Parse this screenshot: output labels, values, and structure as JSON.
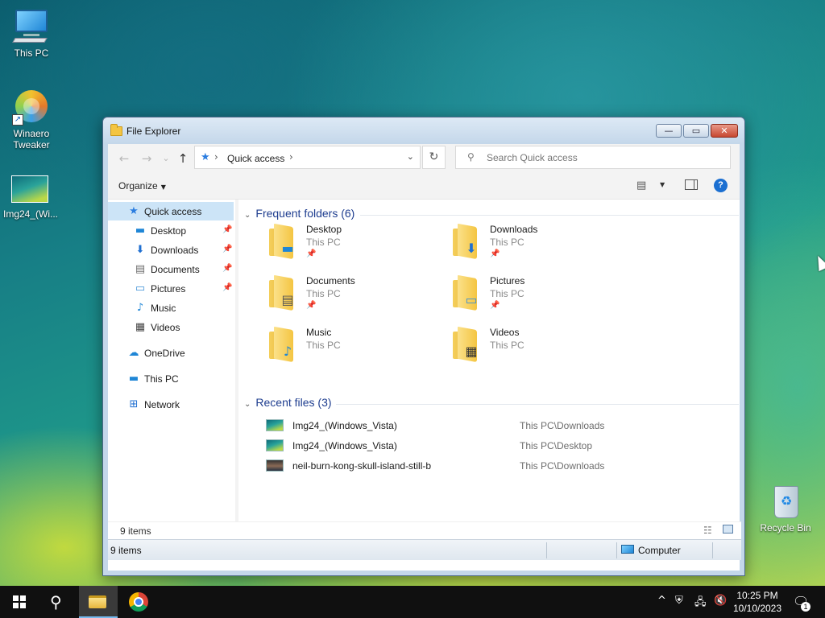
{
  "desktop": {
    "icons": [
      {
        "label": "This PC",
        "icon": "computer-icon"
      },
      {
        "label": "Winaero Tweaker",
        "icon": "winaero-tweaker-icon"
      },
      {
        "label": "Img24_(Wi...",
        "icon": "image-file-icon"
      },
      {
        "label": "Recycle Bin",
        "icon": "recycle-bin-icon"
      }
    ]
  },
  "window": {
    "title": "File Explorer",
    "buttons": {
      "minimize": "—",
      "maximize": "▭",
      "close": "✕"
    },
    "nav": {
      "back": "←",
      "forward": "→",
      "recent": "⌄",
      "up": "↑"
    },
    "address": {
      "location": "Quick access",
      "separator": "›",
      "dropdown": "⌄",
      "refresh": "↻"
    },
    "search": {
      "placeholder": "Search Quick access",
      "value": ""
    },
    "toolbar": {
      "organize": "Organize",
      "help": "?"
    },
    "navpane": [
      {
        "label": "Quick access",
        "icon": "star-icon",
        "glyph": "★",
        "color": "#2b7de0",
        "selected": true,
        "pinned": false,
        "indent": 0
      },
      {
        "label": "Desktop",
        "icon": "desktop-icon",
        "glyph": "▬",
        "color": "#1f86d6",
        "pinned": true,
        "indent": 1
      },
      {
        "label": "Downloads",
        "icon": "downloads-icon",
        "glyph": "⬇",
        "color": "#1f6fd1",
        "pinned": true,
        "indent": 1
      },
      {
        "label": "Documents",
        "icon": "documents-icon",
        "glyph": "▤",
        "color": "#6d6d6d",
        "pinned": true,
        "indent": 1
      },
      {
        "label": "Pictures",
        "icon": "pictures-icon",
        "glyph": "▭",
        "color": "#3a8fd6",
        "pinned": true,
        "indent": 1
      },
      {
        "label": "Music",
        "icon": "music-icon",
        "glyph": "♪",
        "color": "#1f86d6",
        "pinned": false,
        "indent": 1
      },
      {
        "label": "Videos",
        "icon": "videos-icon",
        "glyph": "▦",
        "color": "#444444",
        "pinned": false,
        "indent": 1
      },
      {
        "label": "OneDrive",
        "icon": "onedrive-icon",
        "glyph": "☁",
        "color": "#1f86d6",
        "pinned": false,
        "indent": 0
      },
      {
        "label": "This PC",
        "icon": "this-pc-icon",
        "glyph": "▬",
        "color": "#1f86d6",
        "pinned": false,
        "indent": 0
      },
      {
        "label": "Network",
        "icon": "network-icon",
        "glyph": "⊞",
        "color": "#1f6fd1",
        "pinned": false,
        "indent": 0
      }
    ],
    "pin_glyph": "📌",
    "frequent": {
      "heading": "Frequent folders (6)",
      "items": [
        {
          "name": "Desktop",
          "location": "This PC",
          "pinned": true,
          "badge": "▬",
          "badge_color": "#1f86d6",
          "icon": "desktop-folder-icon"
        },
        {
          "name": "Downloads",
          "location": "This PC",
          "pinned": true,
          "badge": "⬇",
          "badge_color": "#1f6fd1",
          "icon": "downloads-folder-icon"
        },
        {
          "name": "Documents",
          "location": "This PC",
          "pinned": true,
          "badge": "▤",
          "badge_color": "#555555",
          "icon": "documents-folder-icon"
        },
        {
          "name": "Pictures",
          "location": "This PC",
          "pinned": true,
          "badge": "▭",
          "badge_color": "#3a8fd6",
          "icon": "pictures-folder-icon"
        },
        {
          "name": "Music",
          "location": "This PC",
          "pinned": false,
          "badge": "♪",
          "badge_color": "#1f86d6",
          "icon": "music-folder-icon"
        },
        {
          "name": "Videos",
          "location": "This PC",
          "pinned": false,
          "badge": "▦",
          "badge_color": "#333333",
          "icon": "videos-folder-icon"
        }
      ]
    },
    "recent": {
      "heading": "Recent files (3)",
      "items": [
        {
          "name": "Img24_(Windows_Vista)",
          "path": "This PC\\Downloads",
          "thumb": "landscape"
        },
        {
          "name": "Img24_(Windows_Vista)",
          "path": "This PC\\Desktop",
          "thumb": "landscape"
        },
        {
          "name": "neil-burn-kong-skull-island-still-b",
          "path": "This PC\\Downloads",
          "thumb": "dark"
        }
      ]
    },
    "inner_status": {
      "count": "9 items"
    },
    "statusbar": {
      "left": "9 items",
      "zone": "Computer"
    }
  },
  "taskbar": {
    "clock_time": "10:25 PM",
    "clock_date": "10/10/2023",
    "notification_count": "1",
    "tray": {
      "chevron": "^",
      "security": "⛨",
      "network": "🖧",
      "volume": "🔇"
    }
  }
}
